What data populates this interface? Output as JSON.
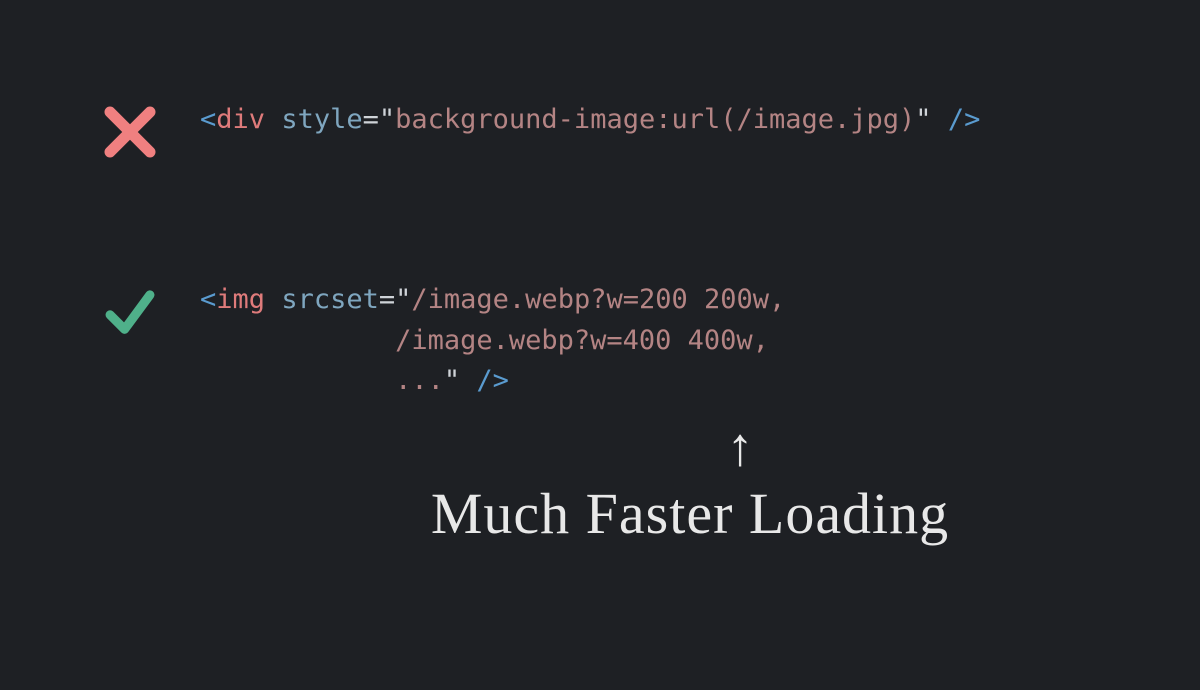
{
  "bad": {
    "open": "<",
    "tag": "div",
    "space": " ",
    "attr": "style",
    "eq": "=",
    "q1": "\"",
    "val": "background-image:url(/image.jpg)",
    "q2": "\"",
    "close": " />"
  },
  "good": {
    "open": "<",
    "tag": "img",
    "space": " ",
    "attr": "srcset",
    "eq": "=",
    "q1": "\"",
    "line1": "/image.webp?w=200 200w,",
    "line2": "            /image.webp?w=400 400w,",
    "line3": "            ...",
    "q2": "\"",
    "close": " />"
  },
  "arrow": "↑",
  "caption": "Much Faster Loading"
}
